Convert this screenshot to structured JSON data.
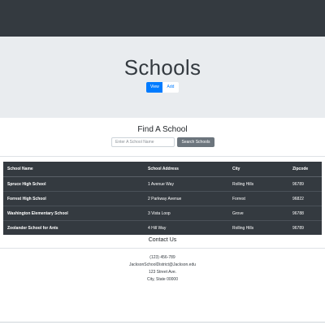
{
  "header": {
    "title": "Schools"
  },
  "actions": {
    "view_label": "View",
    "add_label": "Add"
  },
  "search": {
    "title": "Find A School",
    "placeholder": "Enter A School Name",
    "button_label": "Search Schools"
  },
  "table": {
    "headers": [
      "School Name",
      "School Address",
      "City",
      "Zipcode"
    ],
    "rows": [
      [
        "Spruce High School",
        "1 Avenue Way",
        "Rolling Hills",
        "96789"
      ],
      [
        "Forrest High School",
        "2 Parkway Avenue",
        "Forrest",
        "96822"
      ],
      [
        "Washington Elementary School",
        "3 Vista Loop",
        "Grove",
        "96788"
      ],
      [
        "Zoolander School for Ants",
        "4 Hill Way",
        "Rolling Hills",
        "96789"
      ]
    ]
  },
  "contact": {
    "title": "Contact Us",
    "phone": "(123) 456-789",
    "email": "JacksonSchoolDistrict@Jackson.edu",
    "street": "123 Street Ave.",
    "city_state": "City, State 00000"
  },
  "colors": {
    "navbar": "#343a40",
    "jumbotron": "#e9ecef",
    "primary": "#007bff",
    "secondary": "#6c757d"
  }
}
